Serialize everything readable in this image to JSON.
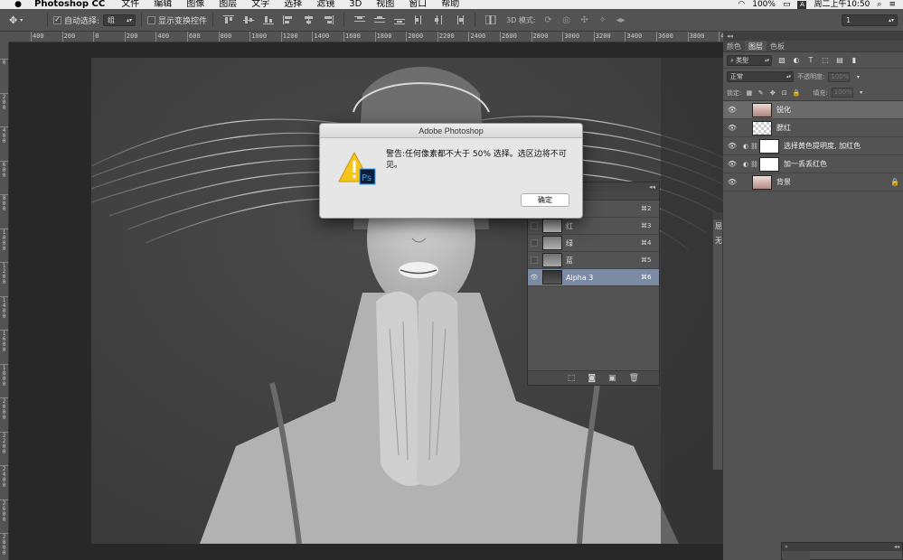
{
  "menubar": {
    "app_name": "Photoshop CC",
    "items": [
      "文件",
      "编辑",
      "图像",
      "图层",
      "文字",
      "选择",
      "滤镜",
      "3D",
      "视图",
      "窗口",
      "帮助"
    ],
    "battery": "100%",
    "input_method": "A",
    "clock": "周二上午10:50"
  },
  "options_bar": {
    "auto_select_label": "自动选择:",
    "auto_select_value": "组",
    "show_transform_label": "显示变换控件",
    "mode_3d_label": "3D 模式:",
    "workspace_value": "1"
  },
  "ruler": {
    "h_labels": [
      "400",
      "200",
      "0",
      "200",
      "400",
      "600",
      "800",
      "1000",
      "1200",
      "1400",
      "1600",
      "1800",
      "2000",
      "2200",
      "2400",
      "2600",
      "2800",
      "3000",
      "3200",
      "3400",
      "3600",
      "3800",
      "4000",
      "4200",
      "4400",
      "4600",
      "4800",
      "5000"
    ],
    "v_labels": [
      "0",
      "2\n0\n0",
      "4\n0\n0",
      "6\n0\n0",
      "8\n0\n0",
      "1\n0\n0\n0",
      "1\n2\n0\n0",
      "1\n4\n0\n0",
      "1\n6\n0\n0",
      "1\n8\n0\n0",
      "2\n0\n0\n0",
      "2\n2\n0\n0",
      "2\n4\n0\n0",
      "2\n6\n0\n0",
      "2\n8\n0\n0"
    ]
  },
  "dialog": {
    "title": "Adobe Photoshop",
    "message": "警告:任何像素都不大于 50% 选择。选区边将不可见。",
    "ok_label": "确定",
    "ps_badge": "Ps"
  },
  "channels": {
    "rows": [
      {
        "name": "",
        "shortcut": "⌘2",
        "active": false
      },
      {
        "name": "红",
        "shortcut": "⌘3",
        "active": false
      },
      {
        "name": "绿",
        "shortcut": "⌘4",
        "active": false
      },
      {
        "name": "蓝",
        "shortcut": "⌘5",
        "active": false
      },
      {
        "name": "Alpha 3",
        "shortcut": "⌘6",
        "active": true
      }
    ]
  },
  "layers_panel": {
    "tabs": [
      "颜色",
      "图层",
      "色板"
    ],
    "active_tab": "图层",
    "filter_type": "类型",
    "blend_mode": "正常",
    "opacity_label": "不透明度:",
    "opacity_value": "100%",
    "lock_label": "锁定:",
    "fill_label": "填充:",
    "fill_value": "100%",
    "layers": [
      {
        "name": "锐化",
        "kind": "photo",
        "active": true
      },
      {
        "name": "腮红",
        "kind": "transparent",
        "active": false
      },
      {
        "name": "选择黄色提明度, 加红色",
        "kind": "adjustment",
        "active": false
      },
      {
        "name": "加一丢丢红色",
        "kind": "adjustment",
        "active": false
      },
      {
        "name": "背景",
        "kind": "photo-locked",
        "active": false
      }
    ]
  },
  "dock_strip": {
    "letters": [
      "屈",
      "无"
    ]
  },
  "colors": {
    "ui_bg": "#535353",
    "canvas_bg": "#282828",
    "active_channel": "#7a8ba3",
    "warning_yellow": "#f5c518",
    "ps_blue": "#31a8ff"
  }
}
